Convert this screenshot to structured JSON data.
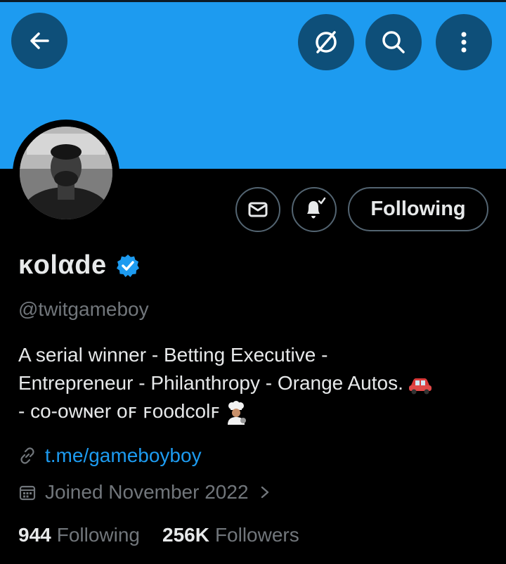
{
  "colors": {
    "banner": "#1d9bf0",
    "topbar_button": "#0e4f79",
    "background": "#000000",
    "text_primary": "#e7e9ea",
    "text_secondary": "#71767b",
    "link": "#1d9bf0",
    "border": "#536471"
  },
  "topbar": {
    "back_icon": "arrow-left-icon",
    "grok_icon": "slashed-circle-icon",
    "search_icon": "search-icon",
    "more_icon": "more-vertical-icon"
  },
  "actions": {
    "message_icon": "envelope-icon",
    "notify_icon": "bell-check-icon",
    "following_label": "Following"
  },
  "profile": {
    "display_name": "ĸolαde",
    "verified_icon": "verified-badge-icon",
    "handle": "@twitgameboy",
    "bio_lines": [
      "A serial winner - Betting Executive -",
      "Entrepreneur - Philanthropy - Orange Autos.",
      "- co-owɴer oꜰ ꜰoodcolꜰ"
    ],
    "link_icon": "link-icon",
    "link": "t.me/gameboyboy",
    "calendar_icon": "calendar-icon",
    "joined": "Joined November 2022",
    "joined_chevron_icon": "chevron-right-icon"
  },
  "stats": {
    "following_count": "944",
    "following_label": "Following",
    "followers_count": "256K",
    "followers_label": "Followers"
  }
}
